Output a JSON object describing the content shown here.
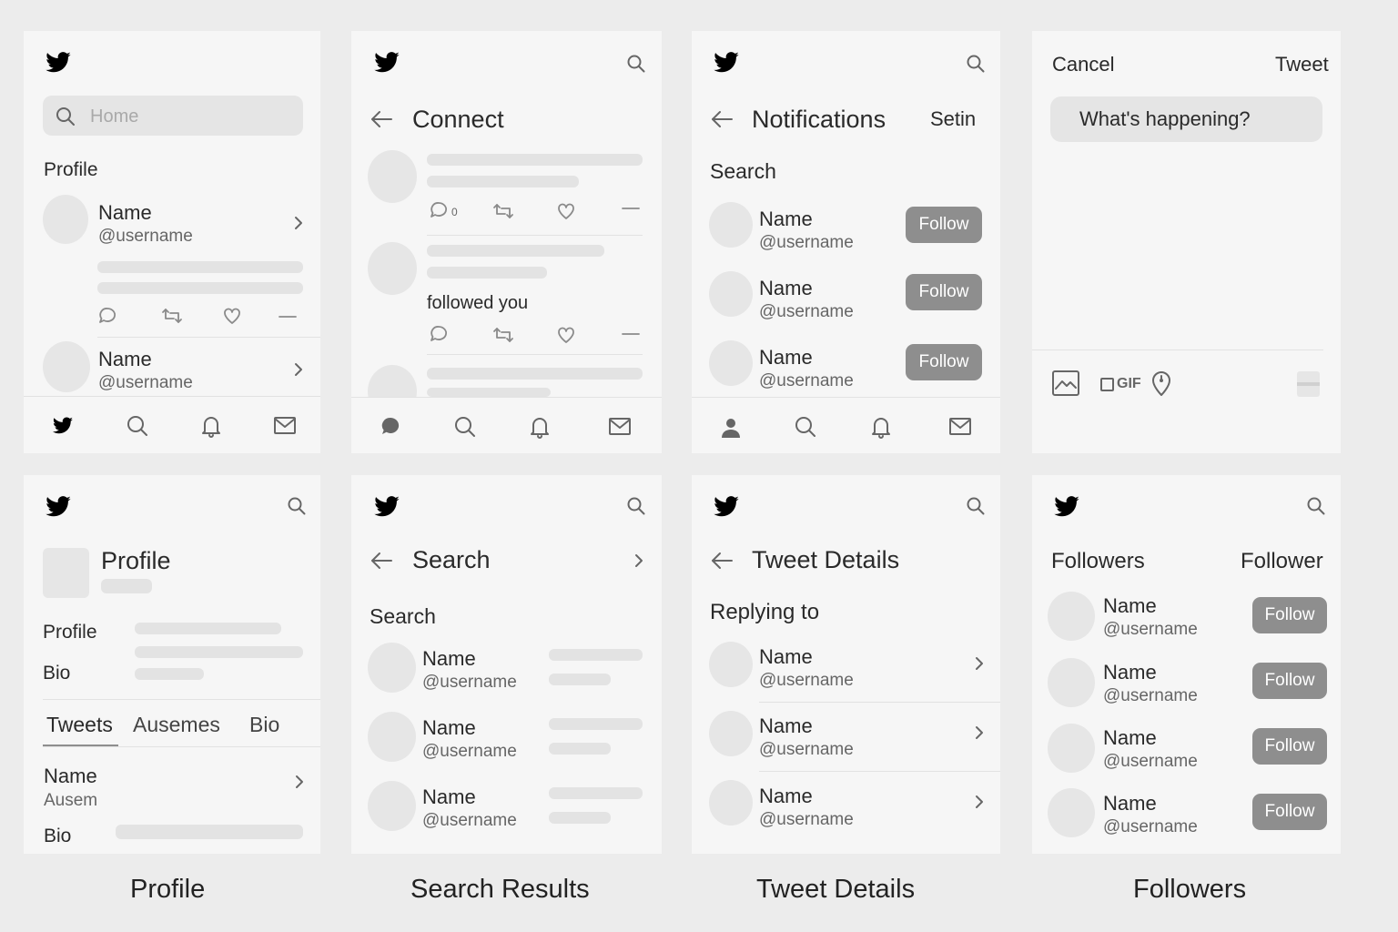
{
  "home": {
    "search_placeholder": "Home",
    "section_label": "Profile",
    "users": [
      {
        "name": "Name",
        "handle": "@username"
      },
      {
        "name": "Name",
        "handle": "@username"
      }
    ]
  },
  "connect": {
    "title": "Connect",
    "reply_count": "0",
    "activity_text": "followed you"
  },
  "notifications": {
    "title": "Notifications",
    "settings_label": "Setin",
    "search_label": "Search",
    "follow_label": "Follow",
    "users": [
      {
        "name": "Name",
        "handle": "@username"
      },
      {
        "name": "Name",
        "handle": "@username"
      },
      {
        "name": "Name",
        "handle": "@username"
      }
    ]
  },
  "compose": {
    "cancel_label": "Cancel",
    "tweet_label": "Tweet",
    "placeholder": "What's happening?",
    "gif_label": "GIF"
  },
  "profile": {
    "title": "Profile",
    "profile_label": "Profile",
    "bio_label": "Bio",
    "tabs": [
      "Tweets",
      "Ausemes",
      "Bio"
    ],
    "item_name": "Name",
    "item_sub": "Ausem",
    "item_bio_label": "Bio",
    "caption": "Profile"
  },
  "search_results": {
    "title": "Search",
    "section_label": "Search",
    "users": [
      {
        "name": "Name",
        "handle": "@username"
      },
      {
        "name": "Name",
        "handle": "@username"
      },
      {
        "name": "Name",
        "handle": "@username"
      }
    ],
    "caption": "Search Results"
  },
  "tweet_details": {
    "title": "Tweet Details",
    "replying_label": "Replying to",
    "users": [
      {
        "name": "Name",
        "handle": "@username"
      },
      {
        "name": "Name",
        "handle": "@username"
      },
      {
        "name": "Name",
        "handle": "@username"
      }
    ],
    "caption": "Tweet Details"
  },
  "followers": {
    "title": "Followers",
    "header_right": "Follower",
    "follow_label": "Follow",
    "users": [
      {
        "name": "Name",
        "handle": "@username"
      },
      {
        "name": "Name",
        "handle": "@username"
      },
      {
        "name": "Name",
        "handle": "@username"
      },
      {
        "name": "Name",
        "handle": "@username"
      }
    ],
    "caption": "Followers"
  },
  "icons": [
    "twitter-bird-icon",
    "search-icon",
    "back-arrow-icon",
    "chevron-right-icon",
    "reply-icon",
    "retweet-icon",
    "like-icon",
    "more-icon",
    "notifications-bell-icon",
    "messages-mail-icon",
    "person-icon",
    "image-icon",
    "gif-icon",
    "location-icon"
  ],
  "colors": {
    "background": "#ececec",
    "panel": "#f6f6f6",
    "skeleton": "#e3e3e3",
    "button": "#8e8e8e",
    "icon": "#666666"
  }
}
